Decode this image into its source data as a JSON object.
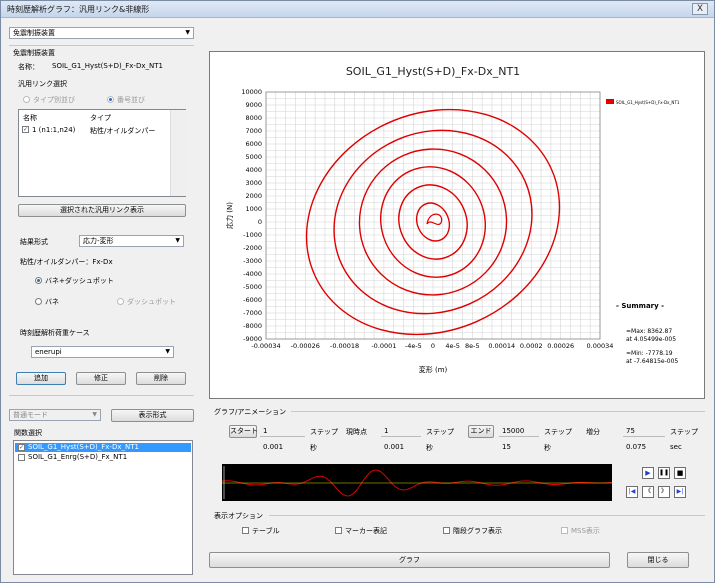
{
  "window": {
    "title": "時刻歴解析グラフ：汎用リンク&非線形",
    "close": "X"
  },
  "top_combo": {
    "value": "免震制振装置"
  },
  "group_title": "免震制振装置",
  "name_label": "名称：",
  "name_value": "SOIL_G1_Hyst(S+D)_Fx-Dx_NT1",
  "link_select_label": "汎用リンク選択",
  "radio_type_order": "タイプ別並び",
  "radio_number_order": "番号並び",
  "list": {
    "col_name": "名称",
    "col_type": "タイプ",
    "rows": [
      {
        "name": "1 (n1:1,n24)",
        "type": "粘性/オイルダンパー",
        "checked": "✓"
      }
    ]
  },
  "show_selected_btn": "選択された汎用リンク表示",
  "result_form_label": "結果形式",
  "result_form_value": "応力-変形",
  "damper_label": "粘性/オイルダンパー：Fx-Dx",
  "radio_spring_dashpot": "バネ+ダッシュポット",
  "radio_spring": "バネ",
  "radio_dashpot": "ダッシュポット",
  "load_case_label": "時刻歴解析荷重ケース",
  "load_case_value": "enerupi",
  "add_btn": "追加",
  "modify_btn": "修正",
  "delete_btn": "削除",
  "mode_combo": "普通モード",
  "display_format_btn": "表示形式",
  "func_select_label": "関数選択",
  "func_items": [
    {
      "label": "SOIL_G1_Hyst(S+D)_Fx-Dx_NT1",
      "checked": "✓"
    },
    {
      "label": "SOIL_G1_Enrg(S+D)_Fx_NT1",
      "checked": ""
    }
  ],
  "colors": {
    "curve": "#e00000",
    "selection": "#3399ff",
    "play_blue": "#1f3fd0"
  },
  "chart_data": {
    "type": "line",
    "title": "SOIL_G1_Hyst(S+D)_Fx-Dx_NT1",
    "xlabel": "変形 (m)",
    "ylabel": "応力 (N)",
    "xlim": [
      -0.00034,
      0.00034
    ],
    "ylim": [
      -9000,
      10000
    ],
    "grid": true,
    "legend_position": "top-right",
    "x_tick_labels": [
      "-0.00034",
      "-0.00026",
      "-0.00018",
      "-0.0001",
      "-4e-5",
      "0",
      "4e-5",
      "8e-5",
      "0.00014",
      "0.0002",
      "0.00026",
      "0.00034"
    ],
    "x_tick_values": [
      -0.00034,
      -0.00026,
      -0.00018,
      -0.0001,
      -4e-05,
      0,
      4e-05,
      8e-05,
      0.00014,
      0.0002,
      0.00026,
      0.00034
    ],
    "y_tick_labels": [
      "10000",
      "9000",
      "8000",
      "7000",
      "6000",
      "5000",
      "4000",
      "3000",
      "2000",
      "1000",
      "0",
      "-1000",
      "-2000",
      "-3000",
      "-4000",
      "-5000",
      "-6000",
      "-7000",
      "-8000",
      "-9000"
    ],
    "series": [
      {
        "name": "SOIL_G1_Hyst(S+D)_Fx-Dx_NT1",
        "color": "#e00000"
      }
    ],
    "loops": [
      {
        "amp_x": 0.000264,
        "amp_y": 8362.87
      },
      {
        "amp_x": 0.000205,
        "amp_y": 6900
      },
      {
        "amp_x": 0.00015,
        "amp_y": 5600
      },
      {
        "amp_x": 0.000105,
        "amp_y": 4300
      },
      {
        "amp_x": 6.8e-05,
        "amp_y": 2900
      },
      {
        "amp_x": 3.2e-05,
        "amp_y": 1500
      }
    ],
    "summary": {
      "title": "- Summary -",
      "max_label": "=Max: 8362.87",
      "max_at": "at 4.05499e-005",
      "min_label": "=Min: -7778.19",
      "min_at": "at -7.64815e-005"
    }
  },
  "animation": {
    "label": "グラフ/アニメーション",
    "start_btn": "スタート",
    "start_value": "1",
    "start_sec": "0.001",
    "current_label": "現時点",
    "current_value": "1",
    "current_sec": "0.001",
    "end_btn": "エンド",
    "end_value": "15000",
    "end_sec": "15",
    "increment_label": "増分",
    "increment_value": "75",
    "increment_sec": "0.075",
    "step_unit": "ステップ",
    "sec_unit_short": "秒",
    "sec_unit": "sec",
    "controls": [
      "▶",
      "❚❚",
      "■",
      "|◀",
      "《",
      "》",
      "▶|"
    ]
  },
  "display_options": {
    "label": "表示オプション",
    "table": "テーブル",
    "marker": "マーカー表記",
    "step_graph": "階段グラフ表示",
    "mss": "MSS表示"
  },
  "graph_btn": "グラフ",
  "close_btn": "閉じる"
}
